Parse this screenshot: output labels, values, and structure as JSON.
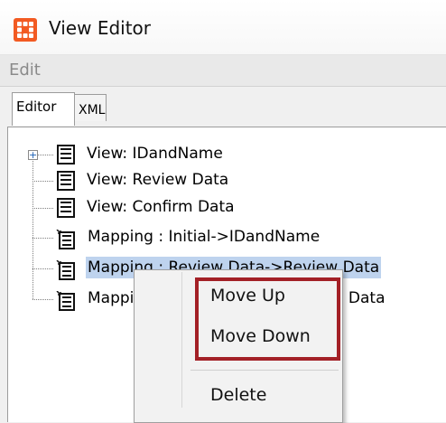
{
  "window": {
    "title": "View Editor",
    "app_icon": "apps-grid-icon",
    "icon_color": "#f25a22"
  },
  "menubar": {
    "items": [
      {
        "label": "Edit"
      }
    ]
  },
  "tabs": [
    {
      "label": "Editor",
      "active": true
    },
    {
      "label": "XML",
      "active": false
    }
  ],
  "tree": {
    "items": [
      {
        "label": "View: IDandName",
        "type": "view",
        "expandable": true,
        "selected": false
      },
      {
        "label": "View: Review Data",
        "type": "view",
        "expandable": false,
        "selected": false
      },
      {
        "label": "View: Confirm Data",
        "type": "view",
        "expandable": false,
        "selected": false
      },
      {
        "label": "Mapping : Initial->IDandName",
        "type": "mapping",
        "expandable": false,
        "selected": false
      },
      {
        "label": "Mapping : Review Data->Review Data",
        "type": "mapping",
        "expandable": false,
        "selected": true
      },
      {
        "label": "Mapping : Review Data->Confirm Data",
        "type": "mapping",
        "expandable": false,
        "selected": false
      }
    ]
  },
  "context_menu": {
    "items": [
      {
        "label": "Move Up"
      },
      {
        "label": "Move Down"
      },
      {
        "label": "Delete"
      }
    ],
    "highlight_color": "#a32026"
  },
  "colors": {
    "selection": "#bed3ee",
    "menu_disabled_text": "#8a8a8a"
  }
}
